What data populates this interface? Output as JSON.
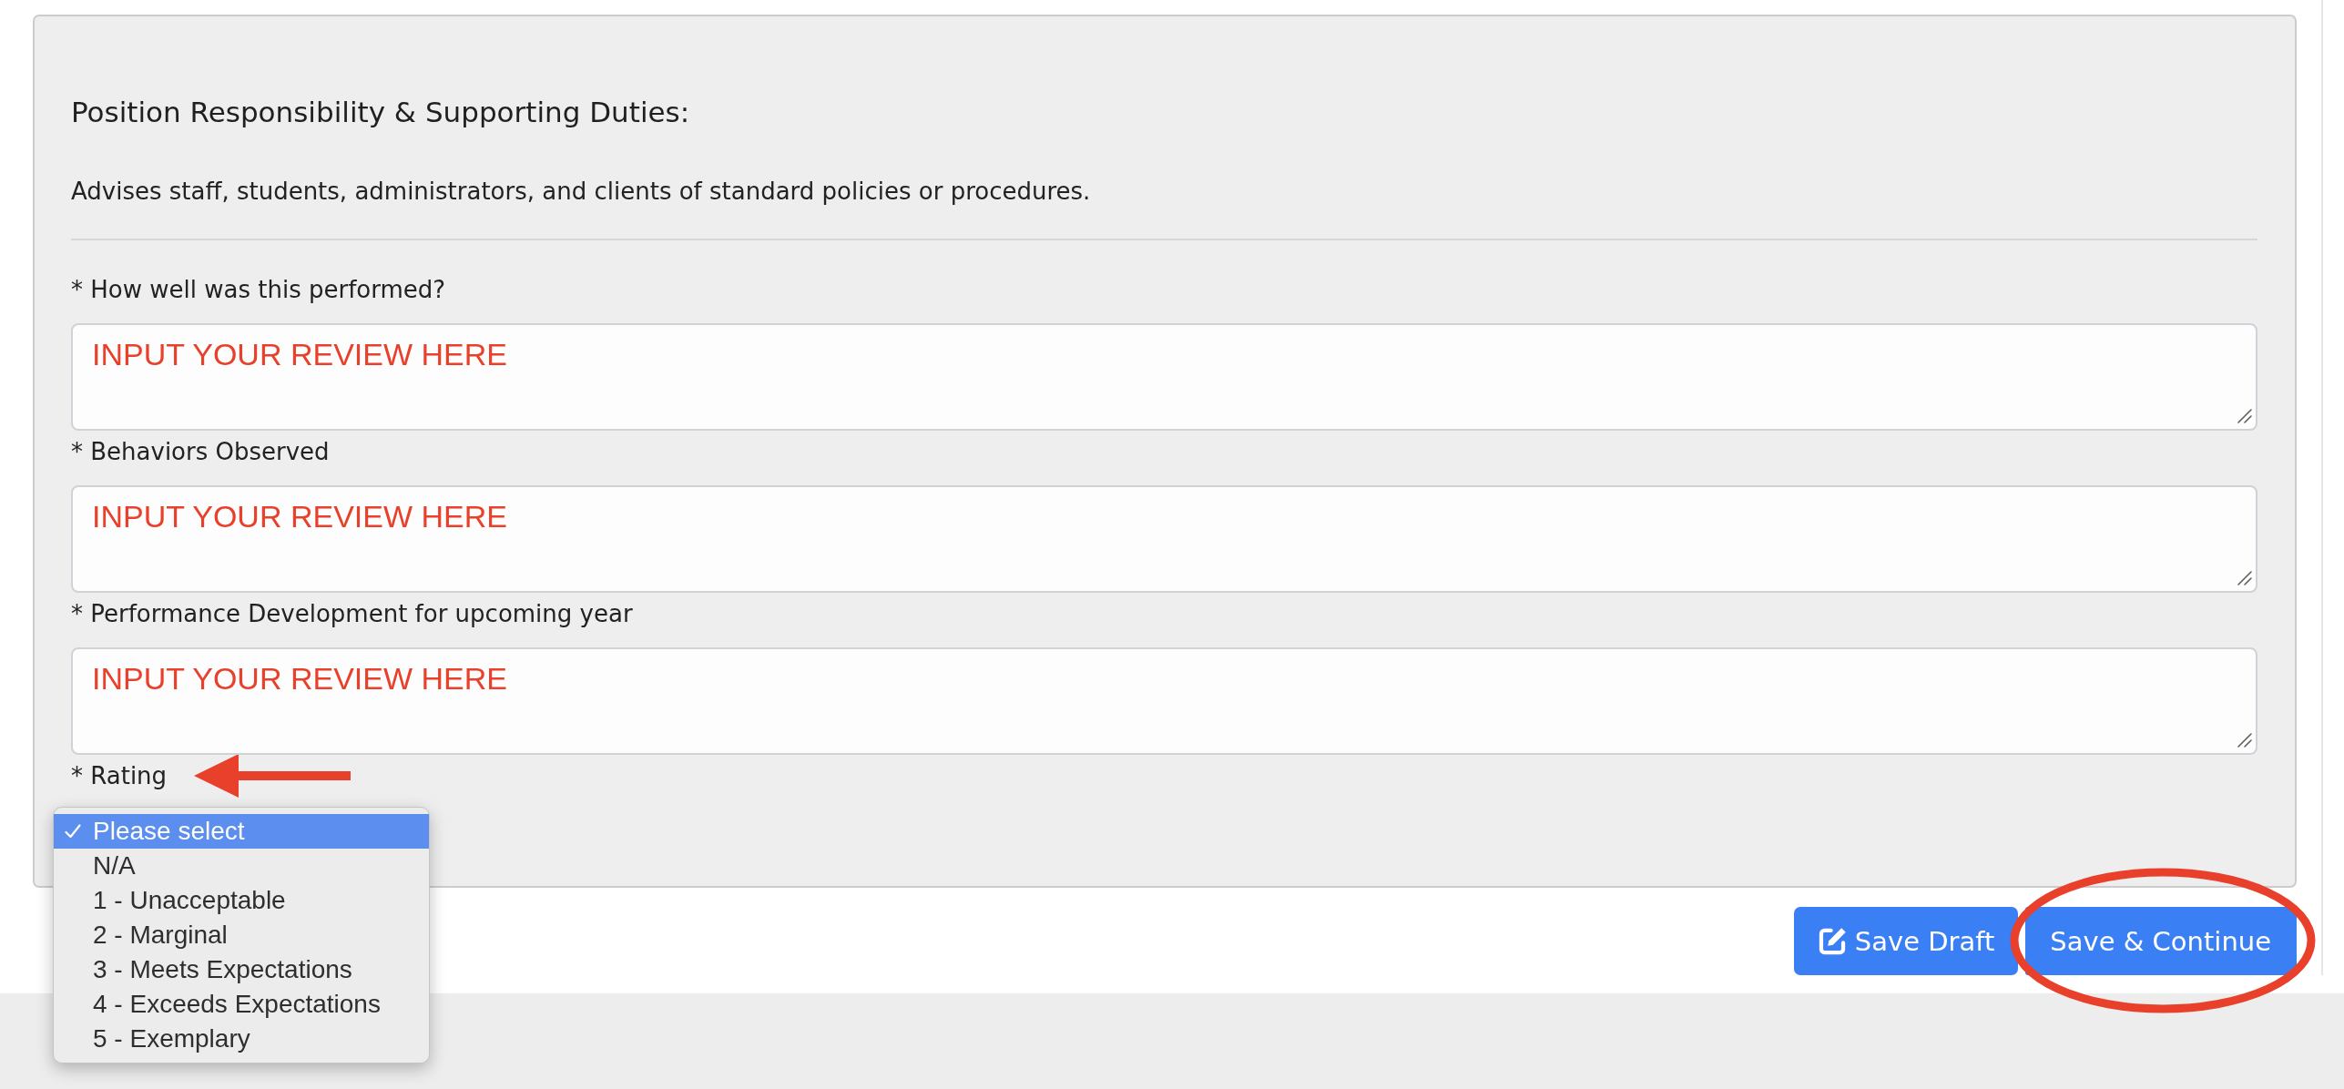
{
  "section": {
    "heading": "Position Responsibility & Supporting Duties:",
    "description": "Advises staff, students, administrators, and clients of standard policies or procedures."
  },
  "fields": [
    {
      "label": "* How well was this performed?",
      "value": "INPUT YOUR REVIEW HERE"
    },
    {
      "label": "* Behaviors Observed",
      "value": "INPUT YOUR REVIEW HERE"
    },
    {
      "label": "* Performance Development for upcoming year",
      "value": "INPUT YOUR REVIEW HERE"
    }
  ],
  "rating": {
    "label": "* Rating",
    "options": [
      {
        "label": "Please select",
        "selected": true
      },
      {
        "label": "N/A",
        "selected": false
      },
      {
        "label": "1 - Unacceptable",
        "selected": false
      },
      {
        "label": "2 - Marginal",
        "selected": false
      },
      {
        "label": "3 - Meets Expectations",
        "selected": false
      },
      {
        "label": "4 - Exceeds Expectations",
        "selected": false
      },
      {
        "label": "5 - Exemplary",
        "selected": false
      }
    ]
  },
  "buttons": [
    {
      "label": "Save Draft",
      "kind": "draft"
    },
    {
      "label": "Save & Continue",
      "kind": "submit"
    }
  ]
}
